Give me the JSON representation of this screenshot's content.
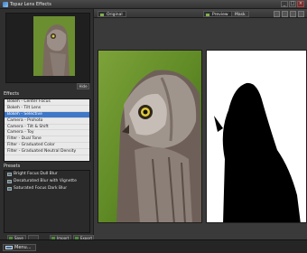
{
  "window": {
    "title": "Topaz Lens Effects"
  },
  "left_panel": {
    "hide_label": "Hide",
    "effects_label": "Effects",
    "effects": [
      "Bokeh - Center Focus",
      "Bokeh - Tilt Lens",
      "Bokeh - Selective",
      "Camera - Prohoto",
      "Camera - Tilt & Shift",
      "Camera - Toy",
      "Filter - Dual Tone",
      "Filter - Graduated Color",
      "Filter - Graduated Neutral Density"
    ],
    "selected_effect": "Bokeh - Selective",
    "presets_label": "Presets",
    "presets": [
      "Bright Focus Dull Blur",
      "Desaturated Blur with Vignette",
      "Saturated Focus Dark Blur"
    ],
    "buttons": {
      "save": "Save",
      "import": "Import",
      "export": "Export"
    }
  },
  "viewer": {
    "original_tab": "Original",
    "preview_tab": "Preview",
    "mask_tab": "Mask"
  },
  "status": {
    "menu_label": "Menu..."
  },
  "colors": {
    "accent": "#3f78c8",
    "background": "#2b2b2b",
    "list_bg": "#e9e9e9"
  }
}
